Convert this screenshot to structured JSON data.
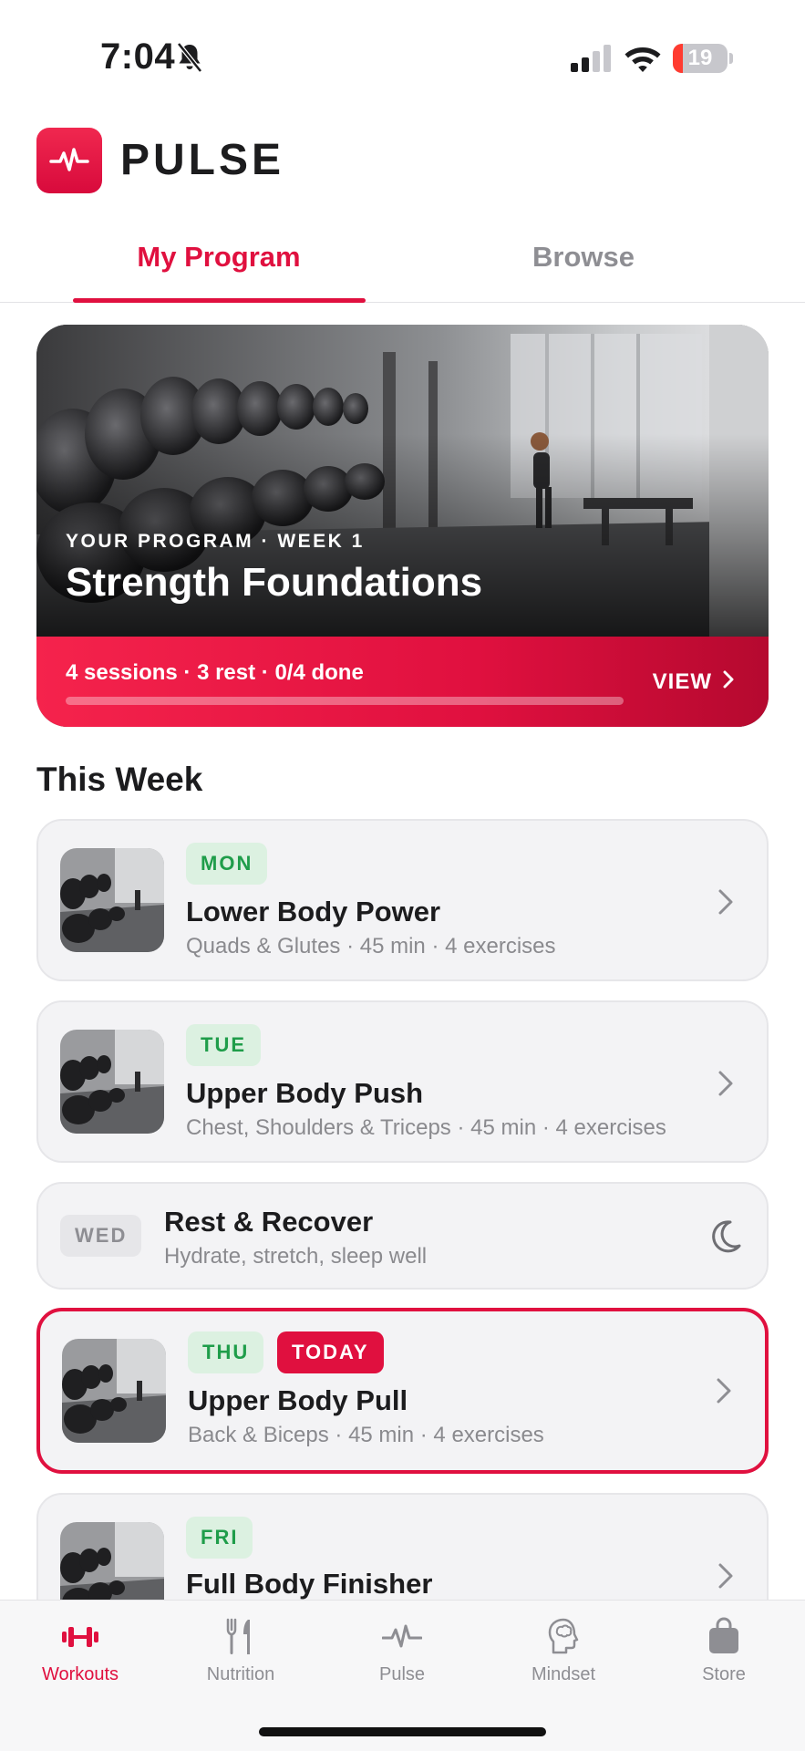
{
  "status_bar": {
    "time": "7:04",
    "battery_level": "19",
    "battery_fraction": 0.19,
    "icons": [
      "bell-slash-icon",
      "cellular-signal-icon",
      "wifi-icon",
      "battery-icon"
    ]
  },
  "header": {
    "app_name": "PULSE",
    "logo_icon": "pulse-waveform-icon"
  },
  "tabs": [
    {
      "label": "My Program",
      "active": true
    },
    {
      "label": "Browse",
      "active": false
    }
  ],
  "hero": {
    "kicker": "YOUR PROGRAM · WEEK 1",
    "title": "Strength Foundations",
    "meta": "4 sessions · 3 rest · 0/4 done",
    "progress_fraction": 0.0,
    "view_label": "VIEW"
  },
  "this_week": {
    "title": "This Week",
    "days": [
      {
        "day": "MON",
        "title": "Lower Body Power",
        "subtitle": "Quads & Glutes · 45 min · 4 exercises"
      },
      {
        "day": "TUE",
        "title": "Upper Body Push",
        "subtitle": "Chest, Shoulders & Triceps · 45 min · 4 exercises"
      },
      {
        "day": "WED",
        "title": "Rest & Recover",
        "subtitle": "Hydrate, stretch, sleep well",
        "rest": true
      },
      {
        "day": "THU",
        "badge": "TODAY",
        "title": "Upper Body Pull",
        "subtitle": "Back & Biceps · 45 min · 4 exercises",
        "today": true
      },
      {
        "day": "FRI",
        "title": "Full Body Finisher",
        "subtitle": ""
      }
    ]
  },
  "tabbar": [
    {
      "label": "Workouts",
      "icon": "dumbbell-icon",
      "active": true
    },
    {
      "label": "Nutrition",
      "icon": "fork-knife-icon",
      "active": false
    },
    {
      "label": "Pulse",
      "icon": "pulse-waveform-icon",
      "active": false
    },
    {
      "label": "Mindset",
      "icon": "brain-head-icon",
      "active": false
    },
    {
      "label": "Store",
      "icon": "shopping-bag-icon",
      "active": false
    }
  ],
  "colors": {
    "accent": "#e0103f",
    "day_badge_bg": "#dcf1e1",
    "day_badge_text": "#1f9d4a",
    "inactive": "#8e8e93"
  }
}
